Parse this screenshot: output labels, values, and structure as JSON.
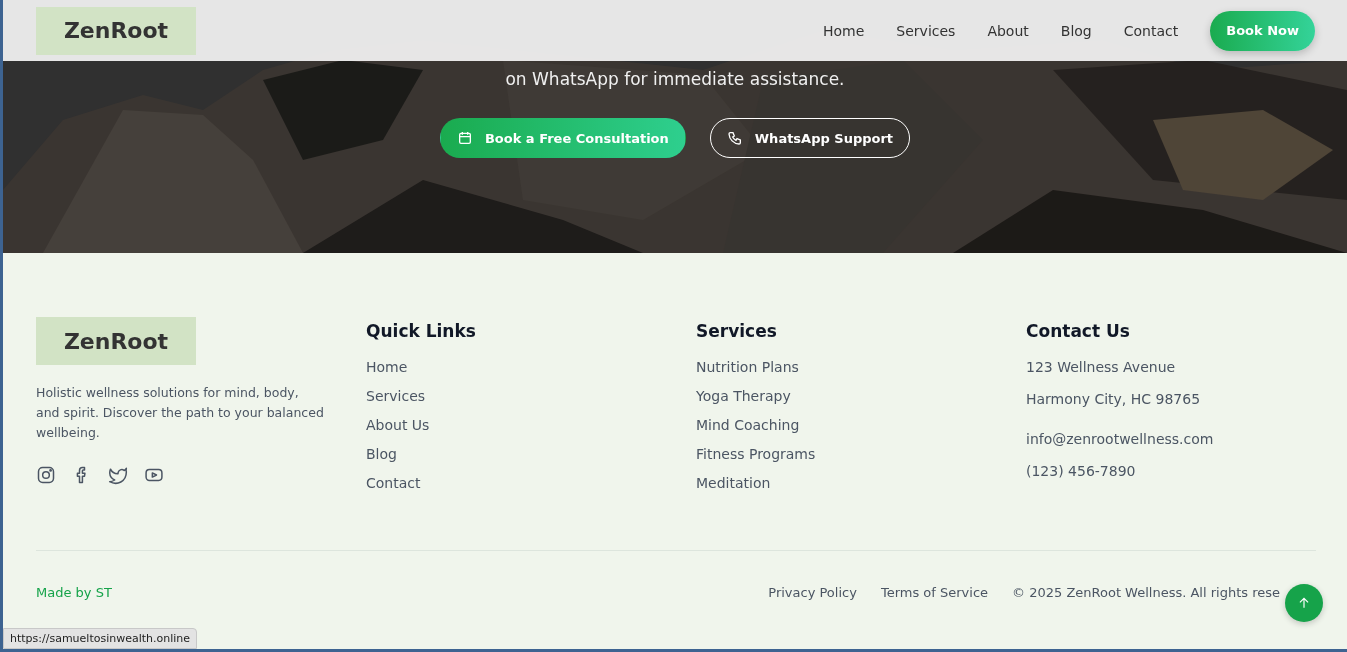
{
  "header": {
    "logo": "ZenRoot",
    "nav": [
      {
        "label": "Home"
      },
      {
        "label": "Services"
      },
      {
        "label": "About"
      },
      {
        "label": "Blog"
      },
      {
        "label": "Contact"
      }
    ],
    "cta": "Book Now"
  },
  "hero": {
    "kind": "picture",
    "text": "on WhatsApp for immediate assistance.",
    "buttons": [
      {
        "label": "Book a Free Consultation",
        "kind": "primary"
      },
      {
        "label": "WhatsApp Support",
        "kind": "outline"
      }
    ]
  },
  "footer": {
    "logo": "ZenRoot",
    "about": "Holistic wellness solutions for mind, body, and spirit. Discover the path to your balanced wellbeing.",
    "social": [
      {
        "kind": "instagram"
      },
      {
        "kind": "facebook"
      },
      {
        "kind": "twitter"
      },
      {
        "kind": "youtube"
      }
    ],
    "columns": [
      {
        "title": "Quick Links",
        "links": [
          "Home",
          "Services",
          "About Us",
          "Blog",
          "Contact"
        ]
      },
      {
        "title": "Services",
        "links": [
          "Nutrition Plans",
          "Yoga Therapy",
          "Mind Coaching",
          "Fitness Programs",
          "Meditation"
        ]
      }
    ],
    "contact": {
      "title": "Contact Us",
      "address": [
        "123 Wellness Avenue",
        "Harmony City, HC 98765"
      ],
      "email": "info@zenrootwellness.com",
      "phone": "(123) 456-7890"
    },
    "made_by": "Made by ST",
    "legal_links": [
      "Privacy Policy",
      "Terms of Service"
    ],
    "copyright": "© 2025 ZenRoot Wellness. All rights rese"
  },
  "status_bar": {
    "url": "https://samueltosinwealth.online"
  }
}
